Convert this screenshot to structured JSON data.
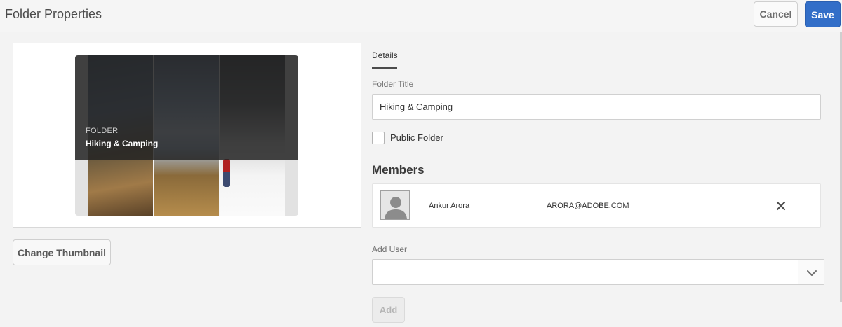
{
  "header": {
    "title": "Folder Properties",
    "cancel_label": "Cancel",
    "save_label": "Save"
  },
  "thumbnail": {
    "kind_label": "FOLDER",
    "folder_name": "Hiking & Camping",
    "change_button_label": "Change Thumbnail"
  },
  "details": {
    "tab_label": "Details",
    "folder_title_label": "Folder Title",
    "folder_title_value": "Hiking & Camping",
    "public_folder_label": "Public Folder",
    "public_folder_checked": false
  },
  "members": {
    "heading": "Members",
    "list": [
      {
        "name": "Ankur Arora",
        "email": "ARORA@ADOBE.COM"
      }
    ]
  },
  "add_user": {
    "label": "Add User",
    "value": "",
    "add_button_label": "Add"
  },
  "colors": {
    "accent": "#326ec8",
    "background": "#f3f3f3"
  },
  "icons": [
    "chevron-down-icon",
    "close-icon",
    "user-avatar-icon"
  ]
}
